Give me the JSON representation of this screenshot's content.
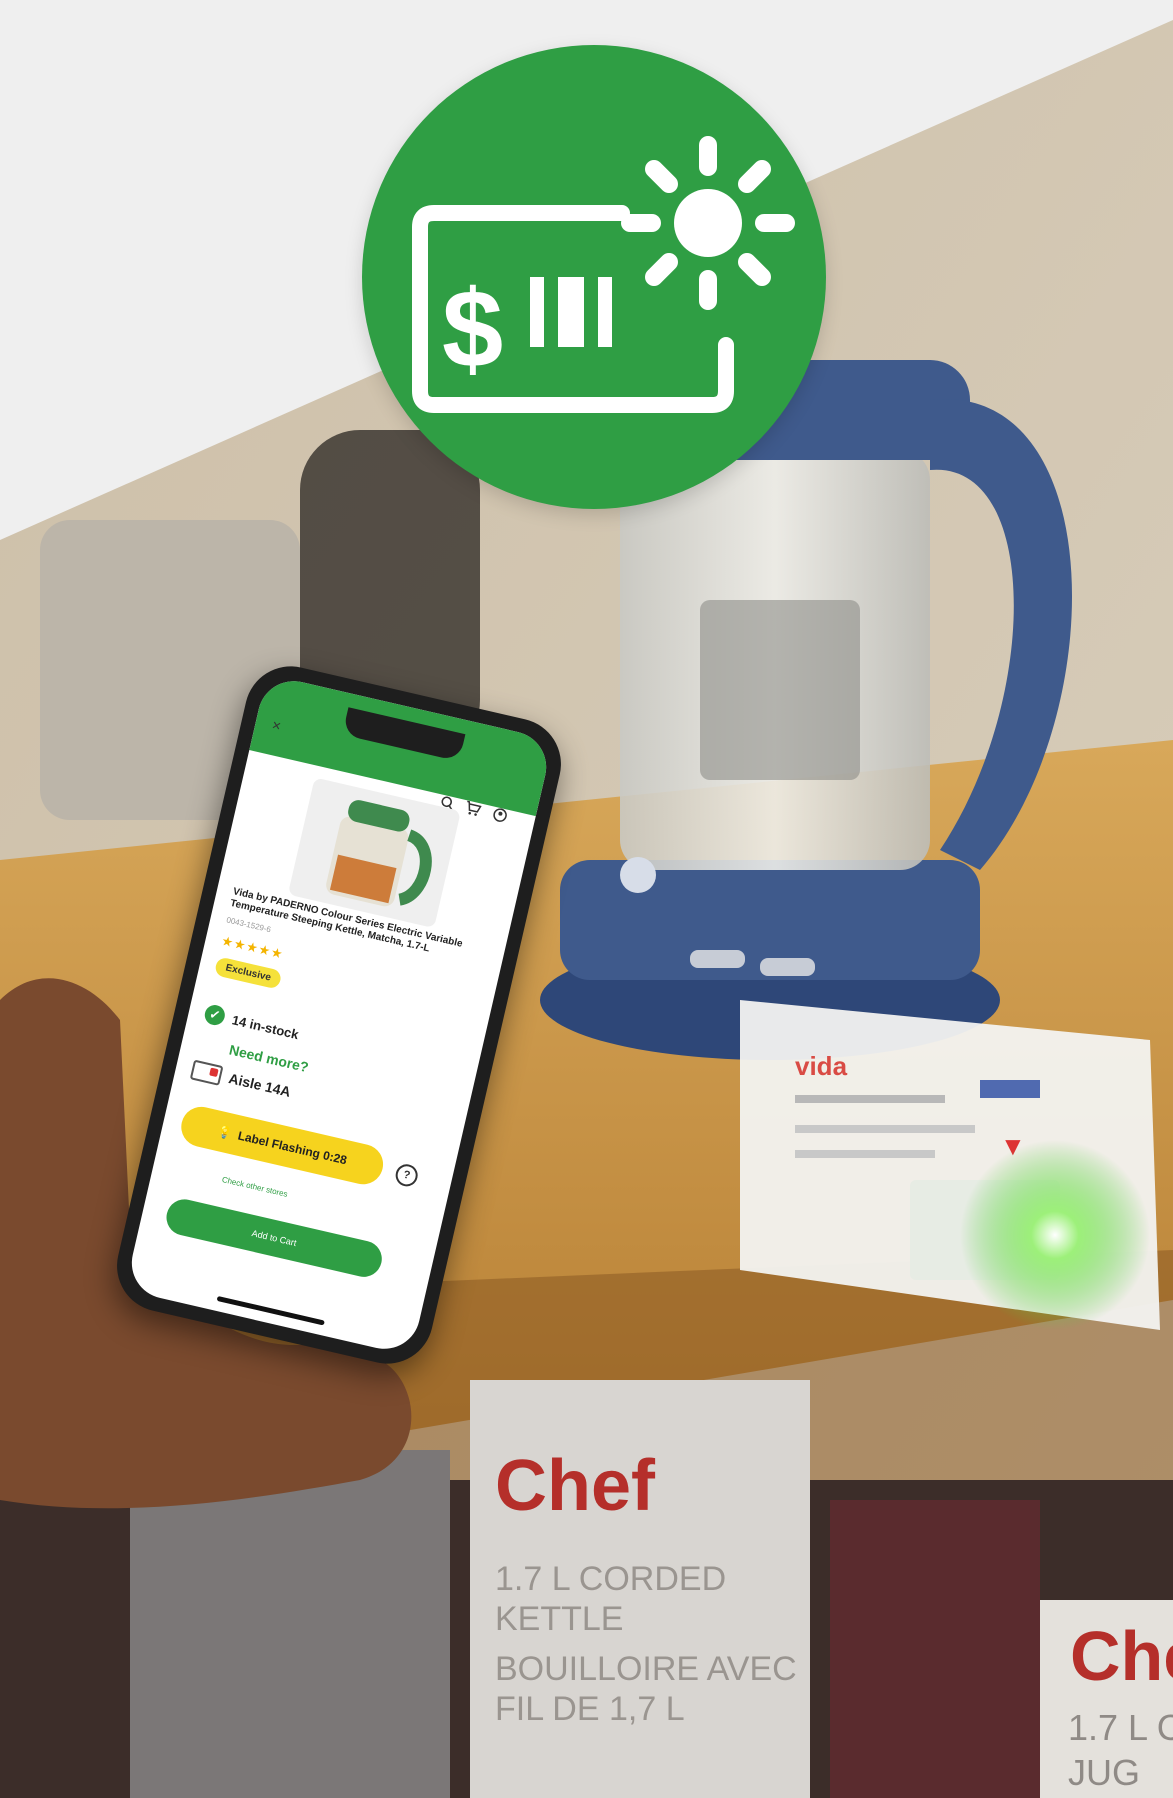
{
  "colors": {
    "brand_green": "#2f9e44",
    "flash_yellow": "#f6d31e",
    "exclusive_yellow": "#f5e13a",
    "shelf_wood": "#c8913f",
    "kettle_blue": "#3f5a8c"
  },
  "badge": {
    "icon": "price-label-flashing-icon",
    "dollar_glyph": "$"
  },
  "phone_app": {
    "header_icons": [
      "close-icon",
      "search-icon",
      "cart-icon",
      "account-icon"
    ],
    "close_glyph": "×",
    "product_title": "Vida by PADERNO Colour Series Electric Variable Temperature Steeping Kettle, Matcha, 1.7-L",
    "product_sku": "0043-1529-6",
    "rating_stars": "★★★★★",
    "badge_label": "Exclusive",
    "stock_text": "14 in-stock",
    "need_more": "Need more?",
    "aisle_text": "Aisle 14A",
    "flash_label": "Label Flashing 0:28",
    "info_glyph": "?",
    "check_other": "Check other stores",
    "add_to_cart": "Add to Cart"
  },
  "shelf_tag": {
    "brand": "vida",
    "price_flag": "▼"
  },
  "box_print": {
    "brand": "Chef",
    "line1": "1.7 L CORDED",
    "line2": "KETTLE",
    "line3": "BOUILLOIRE AVEC",
    "line4": "FIL DE 1,7 L",
    "brand2": "Che",
    "line5": "1.7 L C",
    "line6": "JUG"
  }
}
